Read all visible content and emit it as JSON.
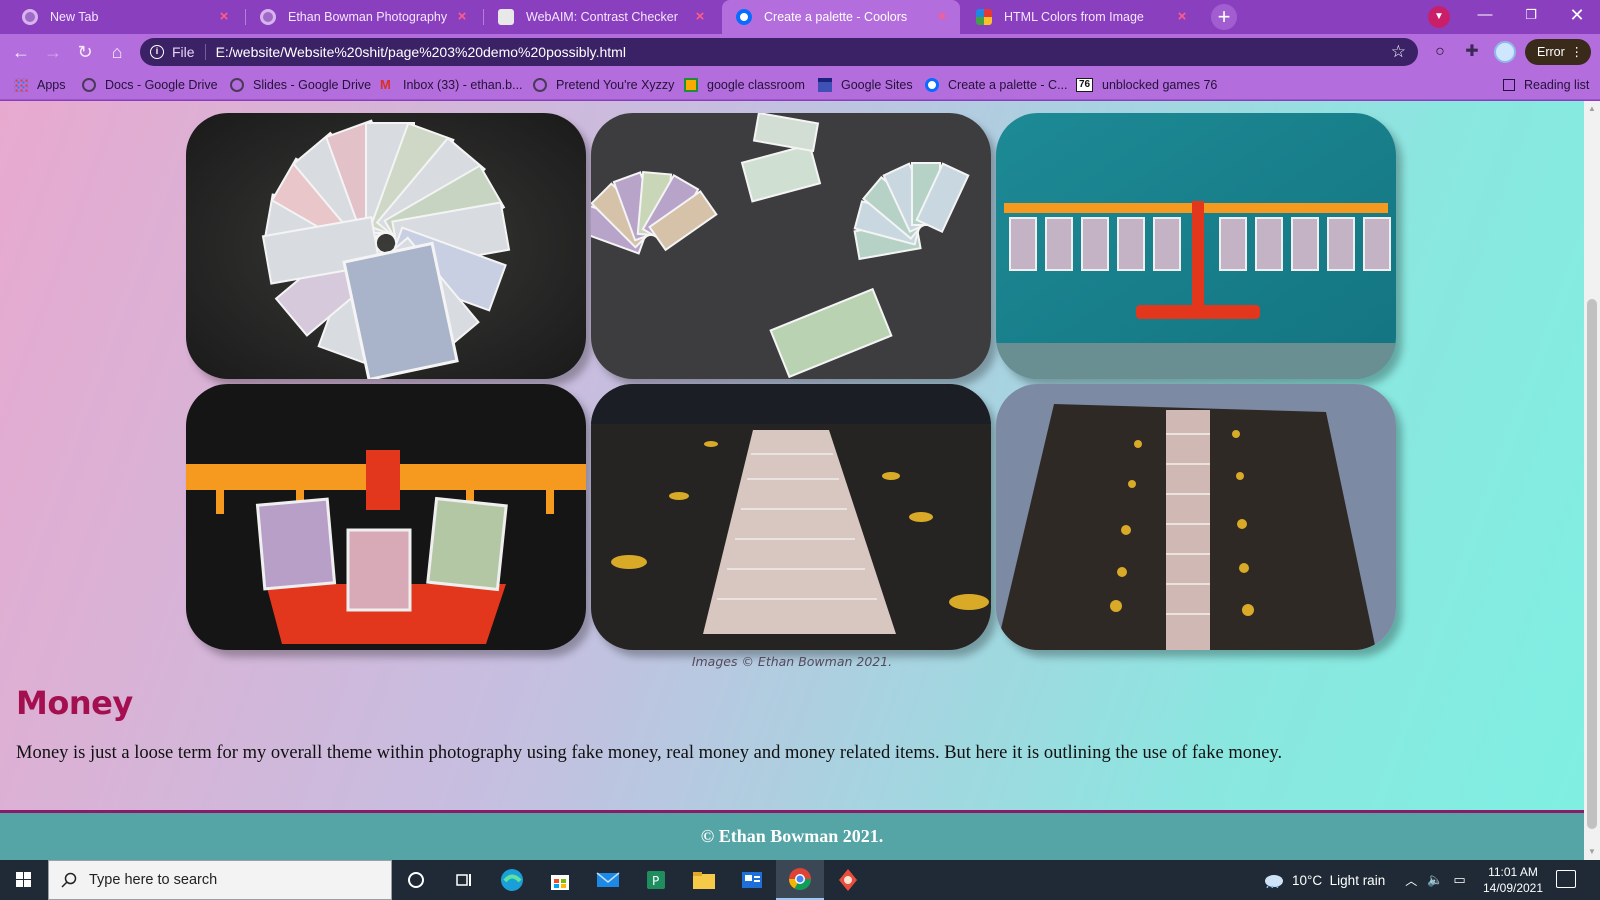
{
  "browser": {
    "tabs": [
      {
        "title": "New Tab",
        "active": false
      },
      {
        "title": "Ethan Bowman Photography",
        "active": false
      },
      {
        "title": "WebAIM: Contrast Checker",
        "active": false
      },
      {
        "title": "Create a palette - Coolors",
        "active": true
      },
      {
        "title": "HTML Colors from Image",
        "active": false
      }
    ],
    "new_tab_symbol": "+",
    "address_scheme": "File",
    "address": "E:/website/Website%20shit/page%203%20demo%20possibly.html",
    "error_chip": "Error",
    "bookmarks": [
      {
        "label": "Apps",
        "icon": "apps-grid-icon"
      },
      {
        "label": "Docs - Google Drive",
        "icon": "globe-icon"
      },
      {
        "label": "Slides - Google Drive",
        "icon": "globe-icon"
      },
      {
        "label": "Inbox (33) - ethan.b...",
        "icon": "gmail-icon"
      },
      {
        "label": "Pretend You're Xyzzy",
        "icon": "globe-icon"
      },
      {
        "label": "google classroom",
        "icon": "classroom-icon"
      },
      {
        "label": "Google Sites",
        "icon": "sites-icon"
      },
      {
        "label": "Create a palette - C...",
        "icon": "coolors-icon"
      },
      {
        "label": "unblocked games 76",
        "icon": "games76-icon"
      }
    ],
    "reading_list": "Reading list"
  },
  "page": {
    "gallery": [
      {
        "name": "photo-notes-fan"
      },
      {
        "name": "photo-notes-scattered"
      },
      {
        "name": "photo-balance-teal"
      },
      {
        "name": "photo-balance-closeup"
      },
      {
        "name": "photo-notes-row-perspective"
      },
      {
        "name": "photo-notes-row-topdown"
      }
    ],
    "caption": "Images © Ethan Bowman 2021.",
    "heading": "Money",
    "paragraph": "Money is just a loose term for my overall theme within photography using fake money, real money and money related items. But here it is outlining the use of fake money.",
    "footer": "© Ethan Bowman 2021."
  },
  "taskbar": {
    "search_placeholder": "Type here to search",
    "weather": "10°C  Light rain",
    "time": "11:01 AM",
    "date": "14/09/2021"
  },
  "colors": {
    "tab_strip": "#8a3fbf",
    "toolbar": "#b46ddc",
    "heading": "#a4104f",
    "footer": "#55a4a6",
    "footer_border": "#8b1b68"
  }
}
